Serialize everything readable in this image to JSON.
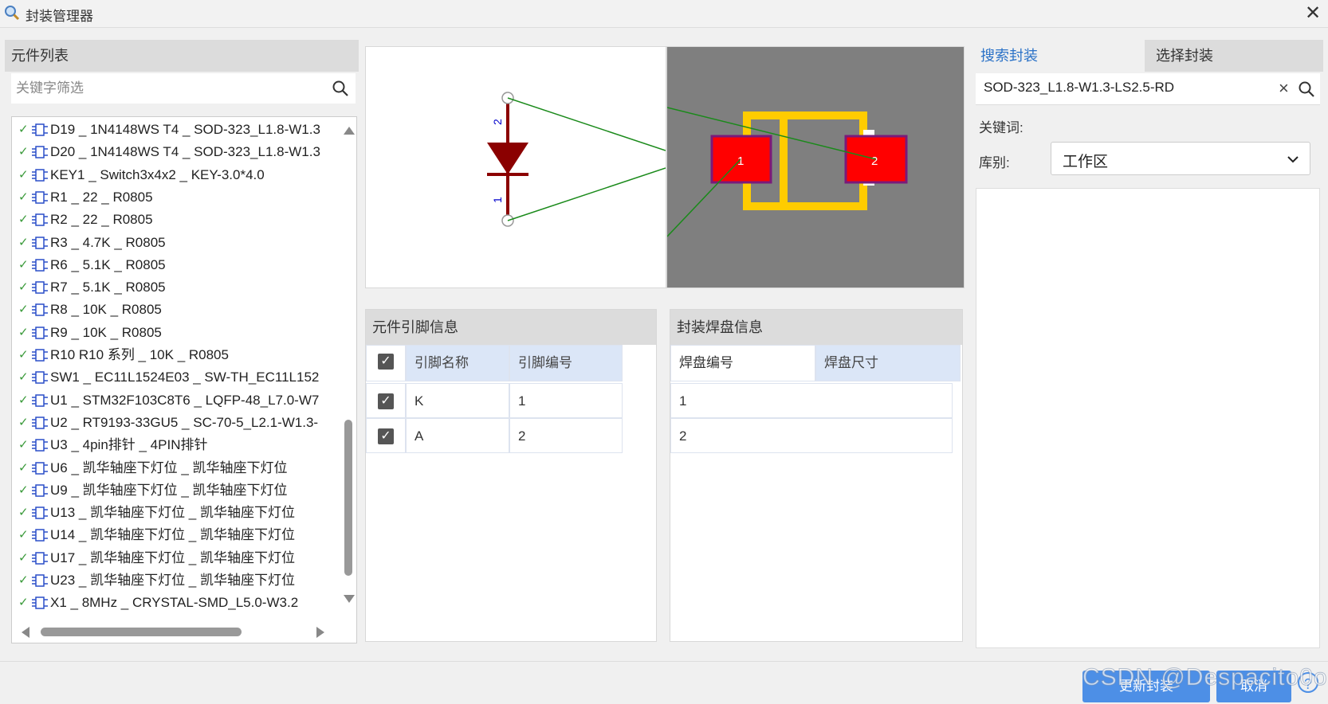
{
  "window": {
    "title": "封装管理器"
  },
  "left_panel": {
    "header": "元件列表",
    "filter_placeholder": "关键字筛选",
    "items": [
      "D19 _ 1N4148WS T4 _ SOD-323_L1.8-W1.3",
      "D20 _ 1N4148WS T4 _ SOD-323_L1.8-W1.3",
      "KEY1 _ Switch3x4x2 _ KEY-3.0*4.0",
      "R1 _ 22 _ R0805",
      "R2 _ 22 _ R0805",
      "R3 _ 4.7K _ R0805",
      "R6 _ 5.1K _ R0805",
      "R7 _ 5.1K _ R0805",
      "R8 _ 10K _ R0805",
      "R9 _ 10K _ R0805",
      "R10  R10 系列 _ 10K _ R0805",
      "SW1 _ EC11L1524E03 _ SW-TH_EC11L152",
      "U1 _ STM32F103C8T6 _ LQFP-48_L7.0-W7",
      "U2 _ RT9193-33GU5 _ SC-70-5_L2.1-W1.3-",
      "U3 _ 4pin排针 _ 4PIN排针",
      "U6 _ 凯华轴座下灯位 _ 凯华轴座下灯位",
      "U9 _ 凯华轴座下灯位 _ 凯华轴座下灯位",
      "U13 _ 凯华轴座下灯位 _ 凯华轴座下灯位",
      "U14 _ 凯华轴座下灯位 _ 凯华轴座下灯位",
      "U17 _ 凯华轴座下灯位 _ 凯华轴座下灯位",
      "U23 _ 凯华轴座下灯位 _ 凯华轴座下灯位",
      "X1 _ 8MHz _ CRYSTAL-SMD_L5.0-W3.2"
    ]
  },
  "preview": {
    "schematic_pins": [
      "2",
      "1"
    ],
    "pcb_pads": [
      "1",
      "2"
    ],
    "colors": {
      "diode": "#8b0000",
      "pad": "#ff0000",
      "silk": "#ffcc00",
      "ratsnest": "#1a8a1a"
    }
  },
  "pin_info": {
    "header": "元件引脚信息",
    "col_name": "引脚名称",
    "col_number": "引脚编号",
    "rows": [
      {
        "name": "K",
        "number": "1"
      },
      {
        "name": "A",
        "number": "2"
      }
    ]
  },
  "pad_info": {
    "header": "封装焊盘信息",
    "col_number": "焊盘编号",
    "col_size": "焊盘尺寸",
    "rows": [
      "1",
      "2"
    ]
  },
  "right_panel": {
    "tab_search": "搜索封装",
    "tab_select": "选择封装",
    "search_value": "SOD-323_L1.8-W1.3-LS2.5-RD",
    "keyword_label": "关键词:",
    "library_label": "库别:",
    "library_value": "工作区"
  },
  "footer": {
    "update_button": "更新封装",
    "cancel_button": "取消",
    "help": "?",
    "watermark": "CSDN @Despacito0o"
  }
}
